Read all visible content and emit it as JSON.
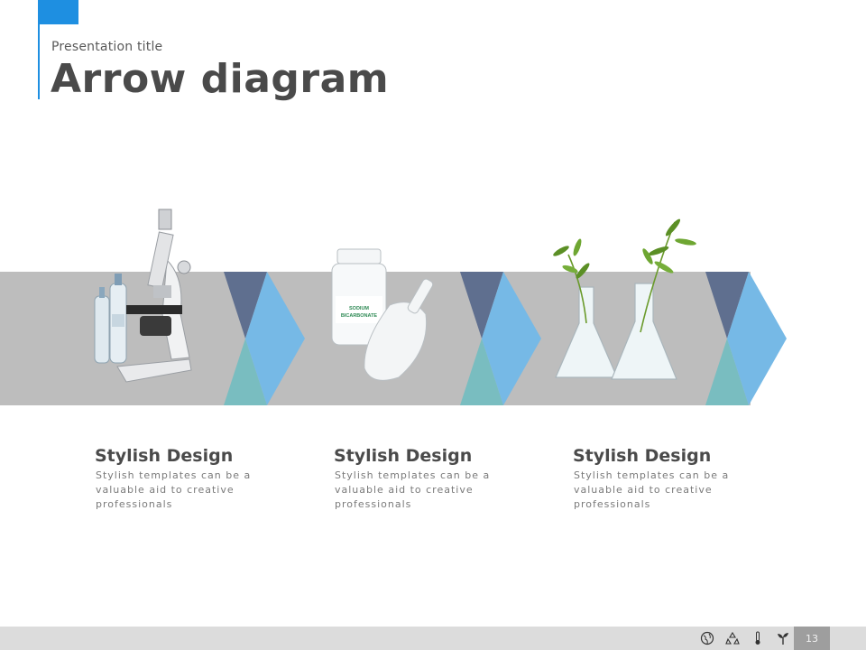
{
  "header": {
    "subtitle": "Presentation title",
    "title": "Arrow diagram"
  },
  "colors": {
    "accent": "#1e8fe1",
    "band": "#bdbdbd",
    "arrow_dark": "#5f6f8f",
    "arrow_light": "#76b9e6",
    "arrow_teal": "#79bdc0"
  },
  "cards": [
    {
      "title": "Stylish Design",
      "text": "Stylish templates can be a valuable aid to creative professionals",
      "image": "microscope-icon"
    },
    {
      "title": "Stylish Design",
      "text": "Stylish templates can be a valuable aid to creative professionals",
      "image": "chemical-jar-icon"
    },
    {
      "title": "Stylish Design",
      "text": "Stylish templates can be a valuable aid to creative professionals",
      "image": "plant-flasks-icon"
    }
  ],
  "jar_label": "SODIUM BICARBONATE",
  "footer": {
    "page_number": "13",
    "icons": [
      "globe-icon",
      "recycle-icon",
      "thermometer-icon",
      "seedling-icon"
    ]
  }
}
